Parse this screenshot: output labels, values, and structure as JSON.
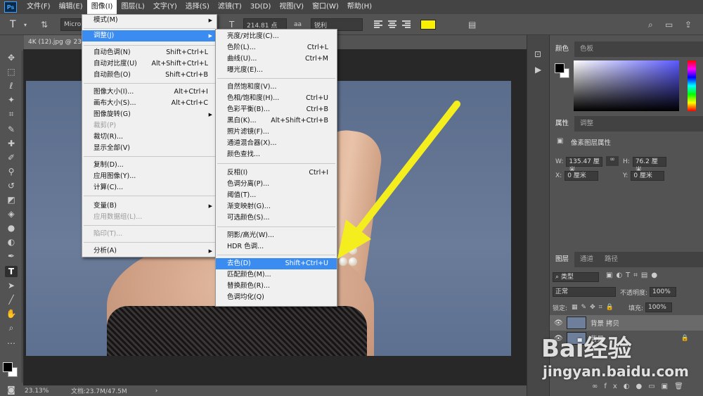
{
  "app": {
    "logo": "Ps"
  },
  "menubar": {
    "items": [
      "文件(F)",
      "编辑(E)",
      "图像(I)",
      "图层(L)",
      "文字(Y)",
      "选择(S)",
      "滤镜(T)",
      "3D(D)",
      "视图(V)",
      "窗口(W)",
      "帮助(H)"
    ]
  },
  "options": {
    "tool_glyph": "T",
    "font_family": "Microso",
    "font_size": "214.81 点",
    "aa_label": "aa",
    "aa_mode": "锐利",
    "text_color": "#f8f000"
  },
  "document": {
    "tab": "4K (12).jpg @ 23.1",
    "zoom": "23.13%",
    "doc_size": "文档:23.7M/47.5M"
  },
  "image_menu": {
    "items": [
      {
        "label": "模式(M)",
        "shortcut": "",
        "submenu": true,
        "disabled": false
      },
      {
        "label": "调整(J)",
        "shortcut": "",
        "submenu": true,
        "disabled": false,
        "highlighted": true
      },
      {
        "label": "自动色调(N)",
        "shortcut": "Shift+Ctrl+L"
      },
      {
        "label": "自动对比度(U)",
        "shortcut": "Alt+Shift+Ctrl+L"
      },
      {
        "label": "自动颜色(O)",
        "shortcut": "Shift+Ctrl+B"
      },
      {
        "label": "图像大小(I)...",
        "shortcut": "Alt+Ctrl+I"
      },
      {
        "label": "画布大小(S)...",
        "shortcut": "Alt+Ctrl+C"
      },
      {
        "label": "图像旋转(G)",
        "shortcut": "",
        "submenu": true
      },
      {
        "label": "裁剪(P)",
        "shortcut": "",
        "disabled": true
      },
      {
        "label": "裁切(R)...",
        "shortcut": ""
      },
      {
        "label": "显示全部(V)",
        "shortcut": ""
      },
      {
        "label": "复制(D)...",
        "shortcut": ""
      },
      {
        "label": "应用图像(Y)...",
        "shortcut": ""
      },
      {
        "label": "计算(C)...",
        "shortcut": ""
      },
      {
        "label": "变量(B)",
        "shortcut": "",
        "submenu": true
      },
      {
        "label": "应用数据组(L)...",
        "shortcut": "",
        "disabled": true
      },
      {
        "label": "陷印(T)...",
        "shortcut": "",
        "disabled": true
      },
      {
        "label": "分析(A)",
        "shortcut": "",
        "submenu": true
      }
    ]
  },
  "adjust_menu": {
    "items": [
      {
        "label": "亮度/对比度(C)...",
        "shortcut": ""
      },
      {
        "label": "色阶(L)...",
        "shortcut": "Ctrl+L"
      },
      {
        "label": "曲线(U)...",
        "shortcut": "Ctrl+M"
      },
      {
        "label": "曝光度(E)...",
        "shortcut": ""
      },
      {
        "label": "自然饱和度(V)...",
        "shortcut": ""
      },
      {
        "label": "色相/饱和度(H)...",
        "shortcut": "Ctrl+U"
      },
      {
        "label": "色彩平衡(B)...",
        "shortcut": "Ctrl+B"
      },
      {
        "label": "黑白(K)...",
        "shortcut": "Alt+Shift+Ctrl+B"
      },
      {
        "label": "照片滤镜(F)...",
        "shortcut": ""
      },
      {
        "label": "通道混合器(X)...",
        "shortcut": ""
      },
      {
        "label": "颜色查找...",
        "shortcut": ""
      },
      {
        "label": "反相(I)",
        "shortcut": "Ctrl+I"
      },
      {
        "label": "色调分离(P)...",
        "shortcut": ""
      },
      {
        "label": "阈值(T)...",
        "shortcut": ""
      },
      {
        "label": "渐变映射(G)...",
        "shortcut": ""
      },
      {
        "label": "可选颜色(S)...",
        "shortcut": ""
      },
      {
        "label": "阴影/高光(W)...",
        "shortcut": ""
      },
      {
        "label": "HDR 色调...",
        "shortcut": ""
      },
      {
        "label": "去色(D)",
        "shortcut": "Shift+Ctrl+U",
        "highlighted": true
      },
      {
        "label": "匹配颜色(M)...",
        "shortcut": ""
      },
      {
        "label": "替换颜色(R)...",
        "shortcut": ""
      },
      {
        "label": "色调均化(Q)",
        "shortcut": ""
      }
    ]
  },
  "color_panel": {
    "tabs": [
      "颜色",
      "色板"
    ]
  },
  "properties_panel": {
    "tabs": [
      "属性",
      "调整"
    ],
    "title": "像素图层属性",
    "w_label": "W:",
    "w_value": "135.47 厘米",
    "h_label": "H:",
    "h_value": "76.2 厘米",
    "x_label": "X:",
    "x_value": "0 厘米",
    "y_label": "Y:",
    "y_value": "0 厘米"
  },
  "layers_panel": {
    "tabs": [
      "图层",
      "通道",
      "路径"
    ],
    "filter_kind": "类型",
    "blend_mode": "正常",
    "opacity_label": "不透明度:",
    "opacity_value": "100%",
    "lock_label": "锁定:",
    "fill_label": "填充:",
    "fill_value": "100%",
    "layers": [
      {
        "name": "背景 拷贝"
      },
      {
        "name": "背景"
      }
    ]
  },
  "watermark": {
    "logo_text": "Bai经验",
    "url": "jingyan.baidu.com"
  },
  "annotation": {
    "arrow_color": "#f5ee1e"
  }
}
